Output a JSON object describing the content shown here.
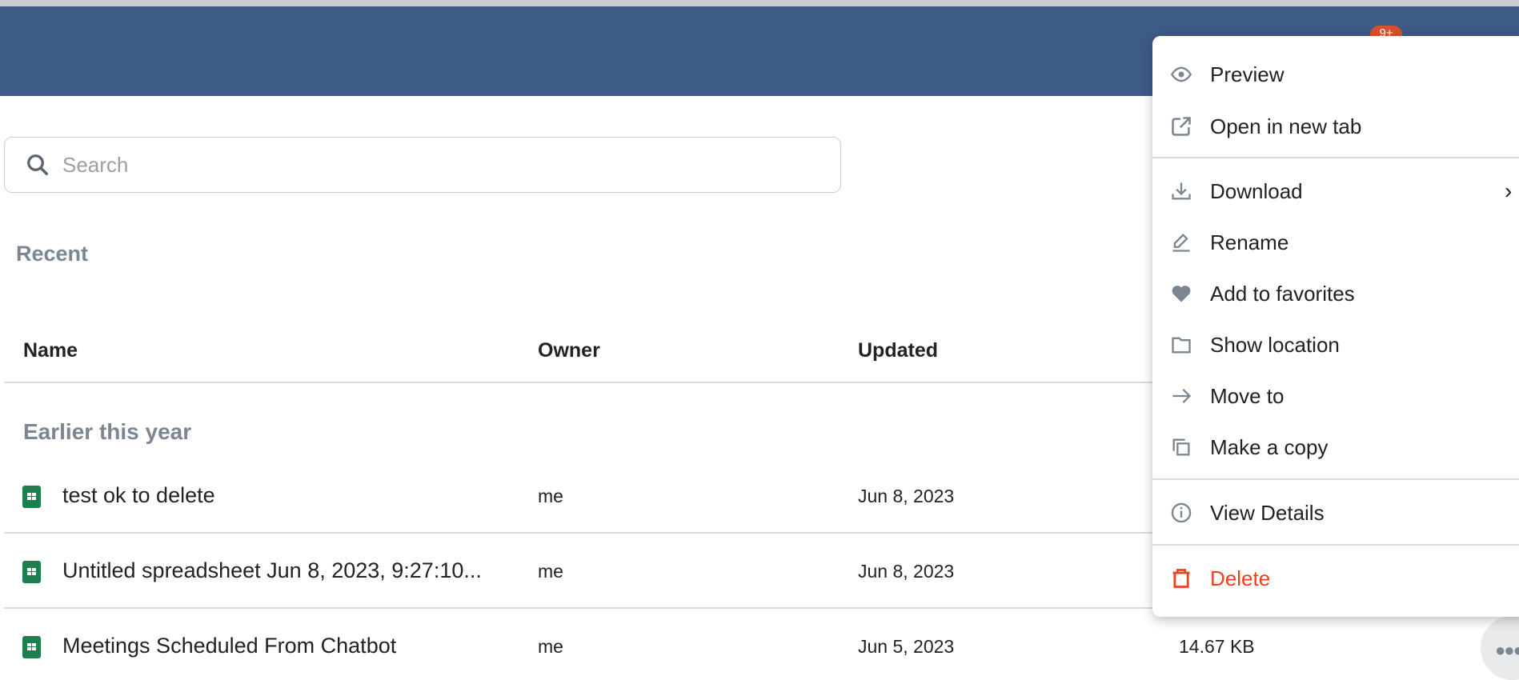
{
  "header": {
    "notification_badge": "9+",
    "brand_color": "#3e5a87"
  },
  "search": {
    "placeholder": "Search",
    "value": ""
  },
  "section_title": "Recent",
  "table": {
    "columns": [
      "Name",
      "Owner",
      "Updated"
    ],
    "group_label": "Earlier this year",
    "rows": [
      {
        "name": "test ok to delete",
        "owner": "me",
        "updated": "Jun 8, 2023",
        "size": ""
      },
      {
        "name": "Untitled spreadsheet Jun 8, 2023, 9:27:10...",
        "owner": "me",
        "updated": "Jun 8, 2023",
        "size": ""
      },
      {
        "name": "Meetings Scheduled From Chatbot",
        "owner": "me",
        "updated": "Jun 5, 2023",
        "size": "14.67 KB"
      }
    ]
  },
  "context_menu": {
    "items": [
      {
        "label": "Preview",
        "icon": "eye-icon"
      },
      {
        "label": "Open in new tab",
        "icon": "external-link-icon"
      },
      {
        "label": "Download",
        "icon": "download-icon"
      },
      {
        "label": "Rename",
        "icon": "pencil-icon"
      },
      {
        "label": "Add to favorites",
        "icon": "heart-icon"
      },
      {
        "label": "Show location",
        "icon": "folder-icon"
      },
      {
        "label": "Move to",
        "icon": "arrow-right-icon"
      },
      {
        "label": "Make a copy",
        "icon": "copy-icon"
      },
      {
        "label": "View Details",
        "icon": "info-icon"
      },
      {
        "label": "Delete",
        "icon": "trash-icon",
        "color": "#f2401e"
      }
    ]
  }
}
